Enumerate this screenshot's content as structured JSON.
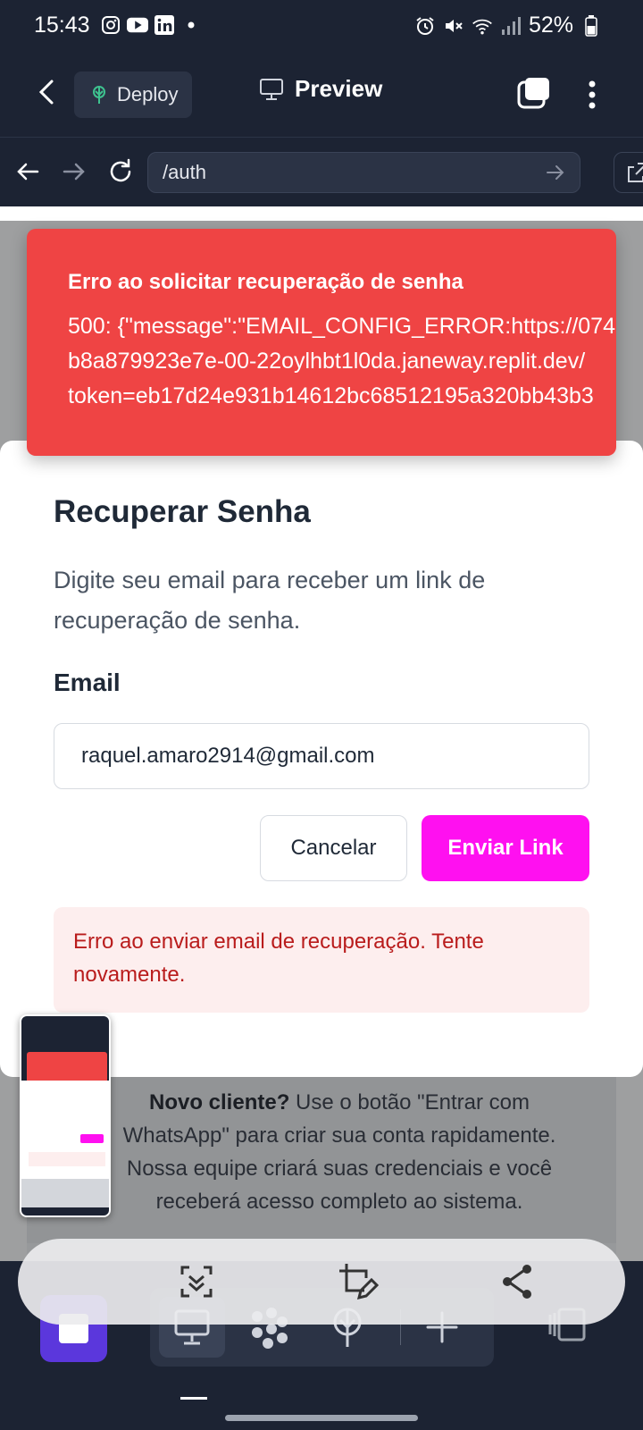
{
  "status_bar": {
    "time": "15:43",
    "battery": "52%",
    "left_icons": [
      "instagram-icon",
      "youtube-icon",
      "linkedin-icon",
      "dot-icon"
    ],
    "right_icons": [
      "alarm-icon",
      "mute-icon",
      "wifi-icon",
      "signal-icon",
      "battery-icon"
    ]
  },
  "app_bar": {
    "deploy_label": "Deploy",
    "preview_label": "Preview"
  },
  "url_bar": {
    "url": "/auth"
  },
  "toast": {
    "title": "Erro ao solicitar recuperação de senha",
    "body_line1": "500: {\"message\":\"EMAIL_CONFIG_ERROR:https://074",
    "body_line2": "b8a879923e7e-00-22oylhbt1l0da.janeway.replit.dev/",
    "body_line3": "token=eb17d24e931b14612bc68512195a320bb43b3",
    "color": "#ef4444"
  },
  "dialog": {
    "title": "Recuperar Senha",
    "description": "Digite seu email para receber um link de recuperação de senha.",
    "email_label": "Email",
    "email_value": "raquel.amaro2914@gmail.com",
    "cancel_label": "Cancelar",
    "send_label": "Enviar Link",
    "send_color": "#ff10f0",
    "error_message": "Erro ao enviar email de recuperação. Tente novamente."
  },
  "background_page": {
    "new_client_bold": "Novo cliente?",
    "new_client_text": " Use o botão \"Entrar com WhatsApp\" para criar sua conta rapidamente. Nossa equipe criará suas credenciais e você receberá acesso completo ao sistema."
  },
  "screenshot_toolbar": {
    "buttons": [
      "scroll-capture-icon",
      "edit-icon",
      "share-icon"
    ]
  },
  "dock": {
    "tabs": [
      "monitor-icon",
      "agent-icon",
      "deploy-icon",
      "plus-icon"
    ],
    "accent": "#5b37dc"
  }
}
